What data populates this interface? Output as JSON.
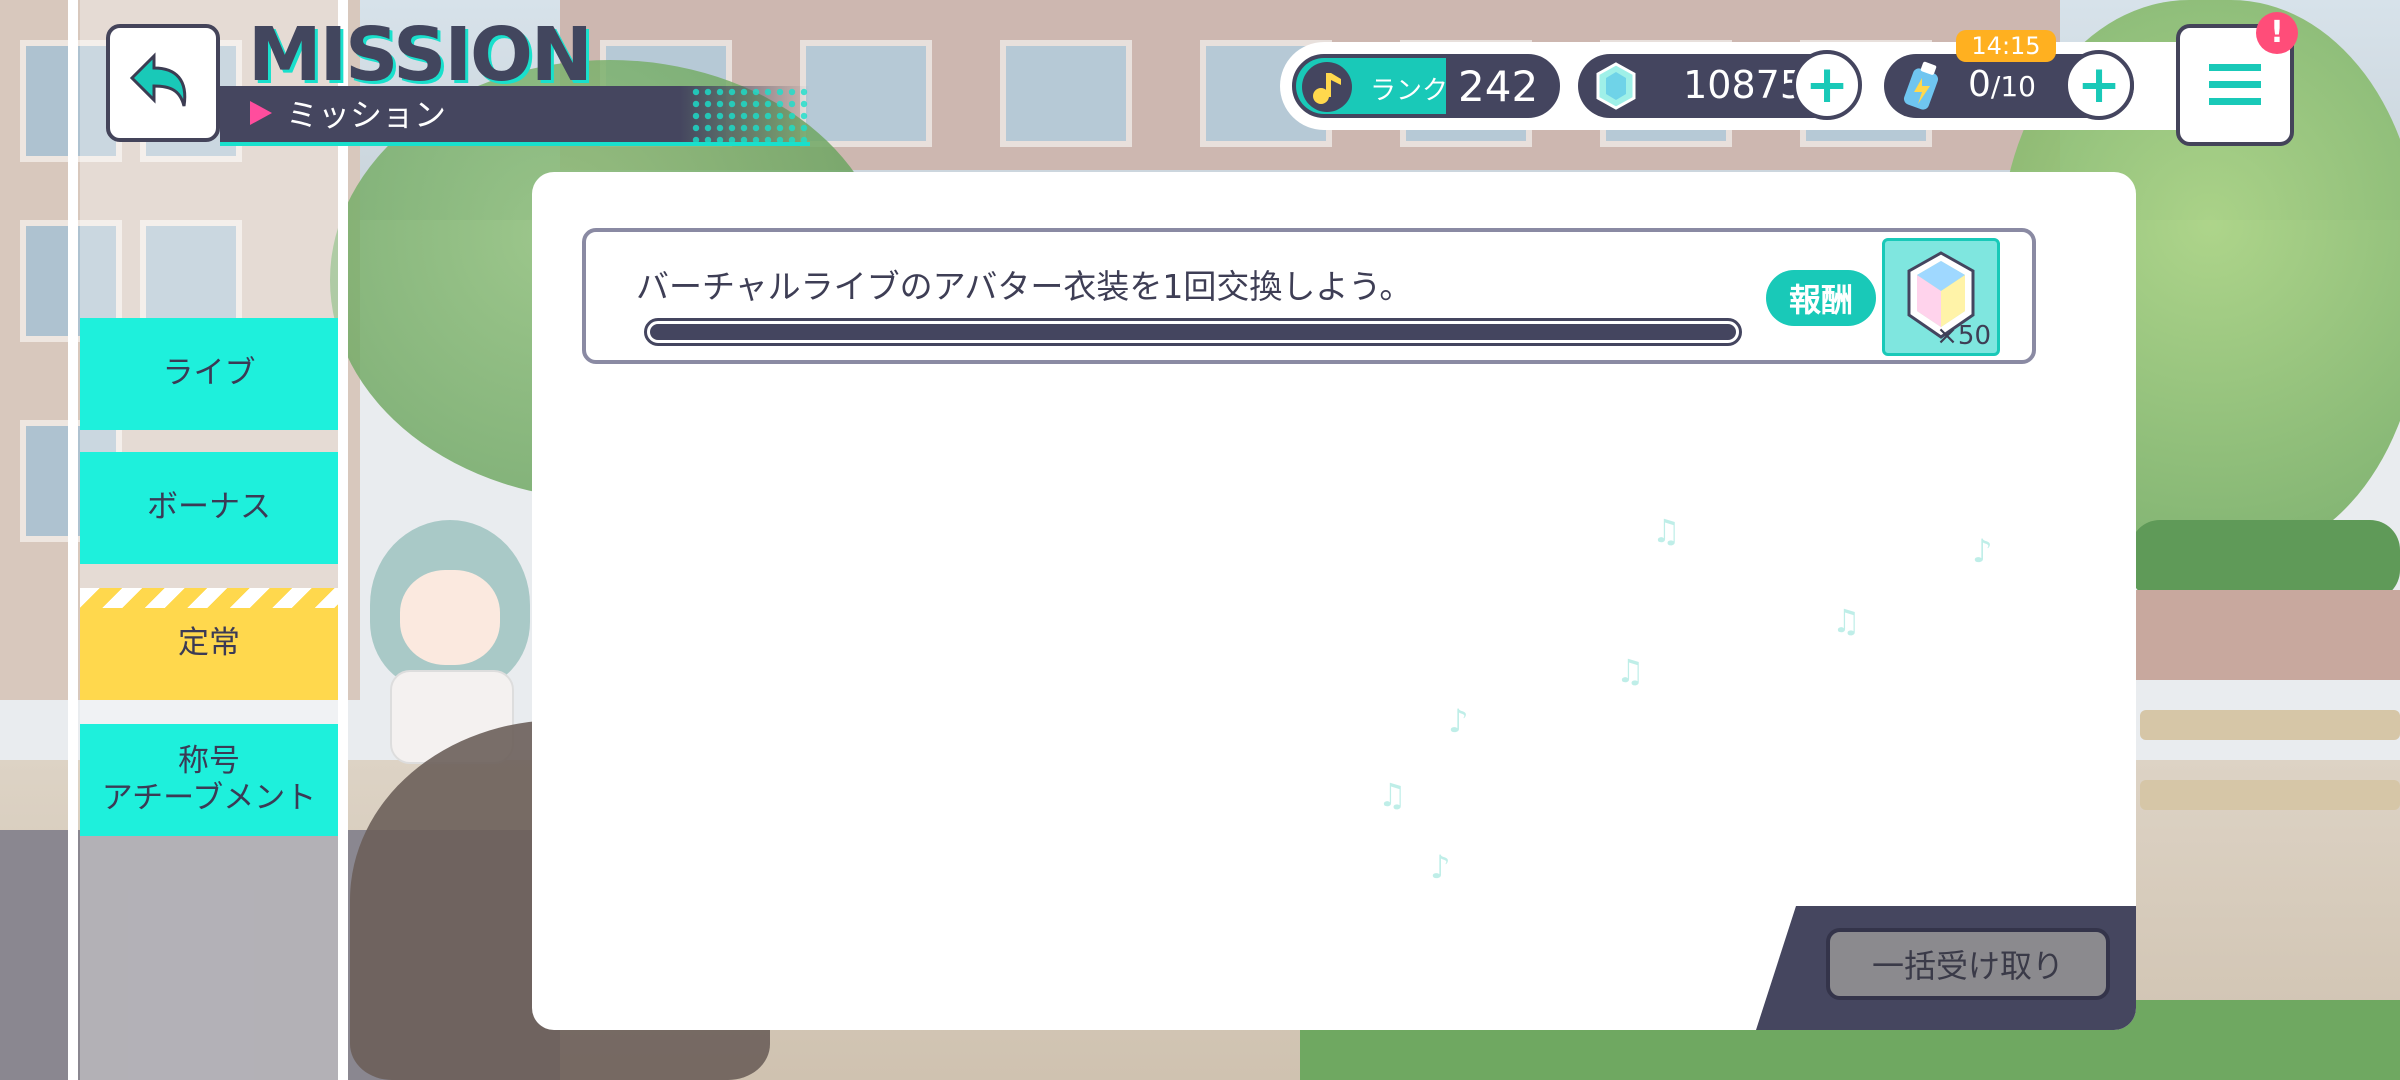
{
  "header": {
    "title_en": "MISSION",
    "title_jp": "ミッション"
  },
  "status": {
    "rank_label": "ランク",
    "rank_value": "242",
    "gems": "10875",
    "energy_current": "0",
    "energy_max": "/10",
    "timer": "14:15",
    "alert": "!"
  },
  "sidebar": {
    "items": [
      {
        "label": "ライブ",
        "active": false
      },
      {
        "label": "ボーナス",
        "active": false
      },
      {
        "label": "定常",
        "active": true
      },
      {
        "label": "称号\nアチーブメント",
        "active": false
      }
    ]
  },
  "missions": [
    {
      "text": "バーチャルライブのアバター衣装を1回交換しよう。",
      "progress": 1.0,
      "reward_label": "報酬",
      "reward_icon": "crystal-icon",
      "reward_count": "×50"
    }
  ],
  "footer": {
    "collect_all_label": "一括受け取り"
  },
  "colors": {
    "accent": "#19c9b8",
    "tab": "#1ef0dc",
    "tab_active": "#ffd84d",
    "navy": "#44455f",
    "alert": "#ff4d79",
    "timer": "#ffb020"
  }
}
